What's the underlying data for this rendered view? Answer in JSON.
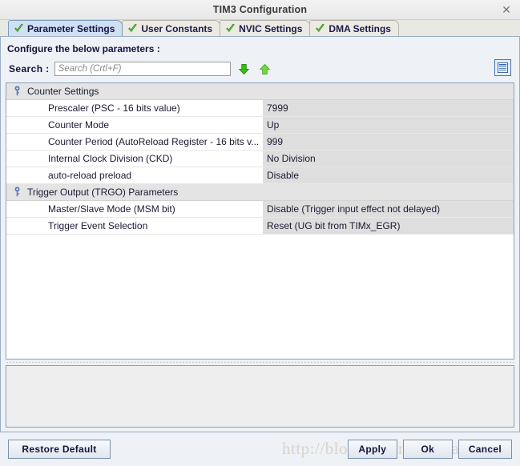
{
  "window": {
    "title": "TIM3 Configuration",
    "close_icon": "close-icon"
  },
  "tabs": [
    {
      "label": "Parameter Settings",
      "icon": "green-check-icon",
      "active": true
    },
    {
      "label": "User Constants",
      "icon": "green-check-icon",
      "active": false
    },
    {
      "label": "NVIC Settings",
      "icon": "green-check-icon",
      "active": false
    },
    {
      "label": "DMA Settings",
      "icon": "green-check-icon",
      "active": false
    }
  ],
  "content": {
    "configure_label": "Configure the below parameters :",
    "search": {
      "label": "Search :",
      "value": "",
      "placeholder": "Search (Crtl+F)",
      "find_next_icon": "arrow-down-icon",
      "find_prev_icon": "arrow-up-icon"
    },
    "view_toggle_icon": "list-view-icon"
  },
  "parameters": [
    {
      "type": "group",
      "label": "Counter Settings",
      "icon": "pin-icon",
      "rows": [
        {
          "name": "Prescaler (PSC - 16 bits value)",
          "value": "7999"
        },
        {
          "name": "Counter Mode",
          "value": "Up"
        },
        {
          "name": "Counter Period (AutoReload Register - 16 bits v...",
          "value": "999"
        },
        {
          "name": "Internal Clock Division (CKD)",
          "value": "No Division"
        },
        {
          "name": "auto-reload preload",
          "value": "Disable"
        }
      ]
    },
    {
      "type": "group",
      "label": "Trigger Output (TRGO) Parameters",
      "icon": "pin-icon",
      "rows": [
        {
          "name": "Master/Slave Mode (MSM bit)",
          "value": "Disable (Trigger input effect not delayed)"
        },
        {
          "name": "Trigger Event Selection",
          "value": "Reset (UG bit from TIMx_EGR)"
        }
      ]
    }
  ],
  "footer": {
    "restore_label": "Restore Default",
    "apply_label": "Apply",
    "ok_label": "Ok",
    "cancel_label": "Cancel"
  },
  "watermark": {
    "text": "http://blog.csdn.net/ouyang"
  },
  "colors": {
    "accent": "#4a74b5",
    "active_tab": "#cfe0f2",
    "check_green": "#58c040",
    "value_cell": "#dedede",
    "group_row": "#e4e4e4"
  }
}
